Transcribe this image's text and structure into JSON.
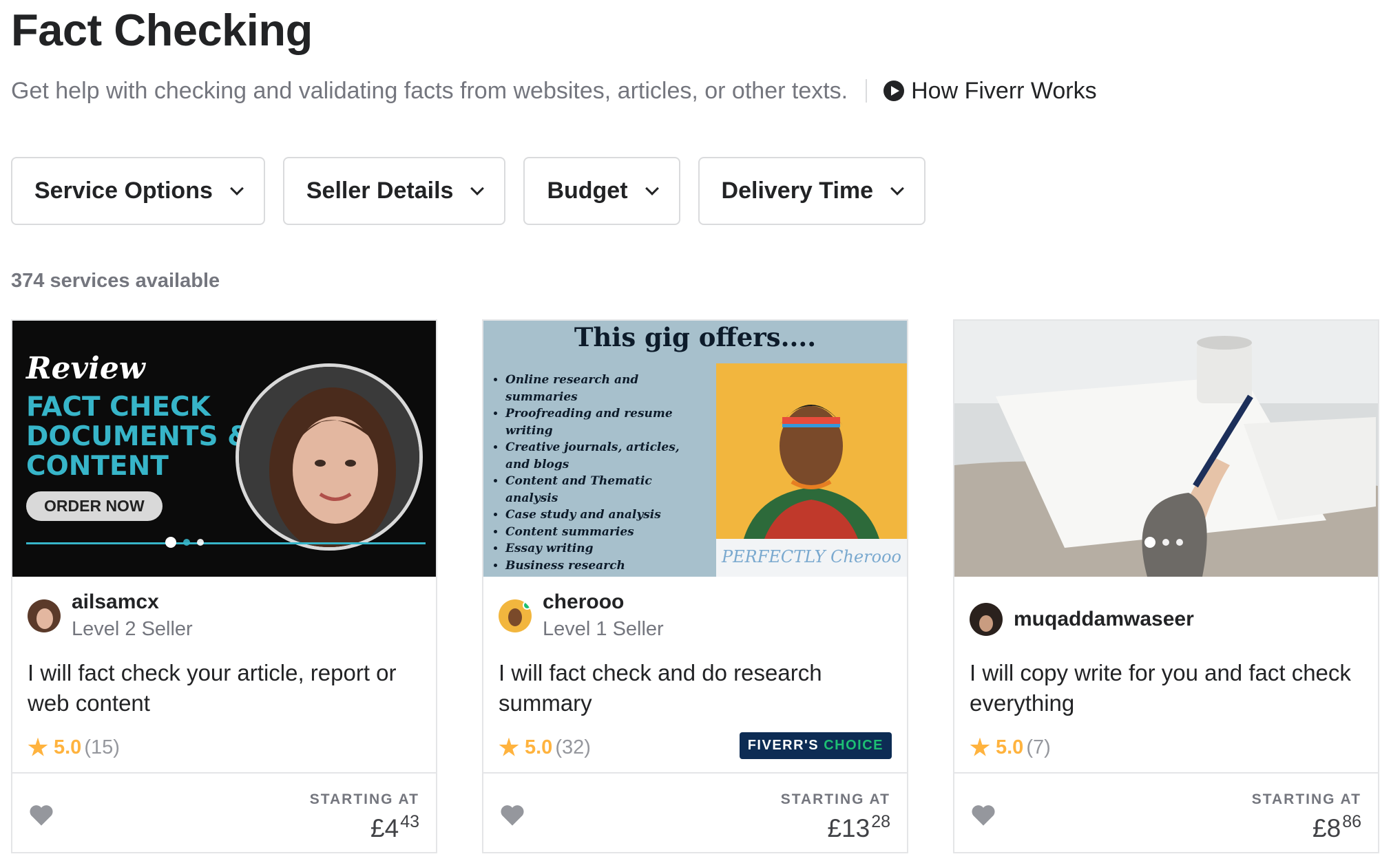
{
  "page": {
    "title": "Fact Checking",
    "subtitle": "Get help with checking and validating facts from websites, articles, or other texts.",
    "how_link": "How Fiverr Works"
  },
  "filters": [
    "Service Options",
    "Seller Details",
    "Budget",
    "Delivery Time"
  ],
  "services_count": "374 services available",
  "labels": {
    "starting_at": "STARTING AT",
    "fiverr_choice_a": "FIVERR'S",
    "fiverr_choice_b": "CHOICE"
  },
  "gigs": [
    {
      "seller": "ailsamcx",
      "level": "Level 2 Seller",
      "title": "I will fact check your article, report or web content",
      "rating": "5.0",
      "reviews": "(15)",
      "price_main": "£4",
      "price_cents": "43",
      "thumb": {
        "review": "Review",
        "big_lines": [
          "FACT CHECK",
          "DOCUMENTS &",
          "CONTENT"
        ],
        "order_btn": "ORDER NOW"
      }
    },
    {
      "seller": "cherooo",
      "level": "Level 1 Seller",
      "title": "I will fact check and do research summary",
      "rating": "5.0",
      "reviews": "(32)",
      "price_main": "£13",
      "price_cents": "28",
      "fiverrs_choice": true,
      "thumb": {
        "heading": "This gig offers....",
        "items": [
          "Online research and summaries",
          "Proofreading and resume writing",
          "Creative journals, articles, and blogs",
          "Content and Thematic analysis",
          "Case study and analysis",
          "Content summaries",
          "Essay writing",
          "Business research"
        ],
        "logo": "PERFECTLY Cherooo"
      }
    },
    {
      "seller": "muqaddamwaseer",
      "level": "",
      "title": "I will copy write for you and fact check everything",
      "rating": "5.0",
      "reviews": "(7)",
      "price_main": "£8",
      "price_cents": "86"
    }
  ],
  "colors": {
    "brand_green": "#1dbf73",
    "star": "#ffb33e",
    "choice_bg": "#0d2c54",
    "accent_teal": "#37b5c9"
  },
  "icons": [
    "play-icon",
    "chevron-down-icon",
    "star-icon",
    "heart-icon"
  ]
}
